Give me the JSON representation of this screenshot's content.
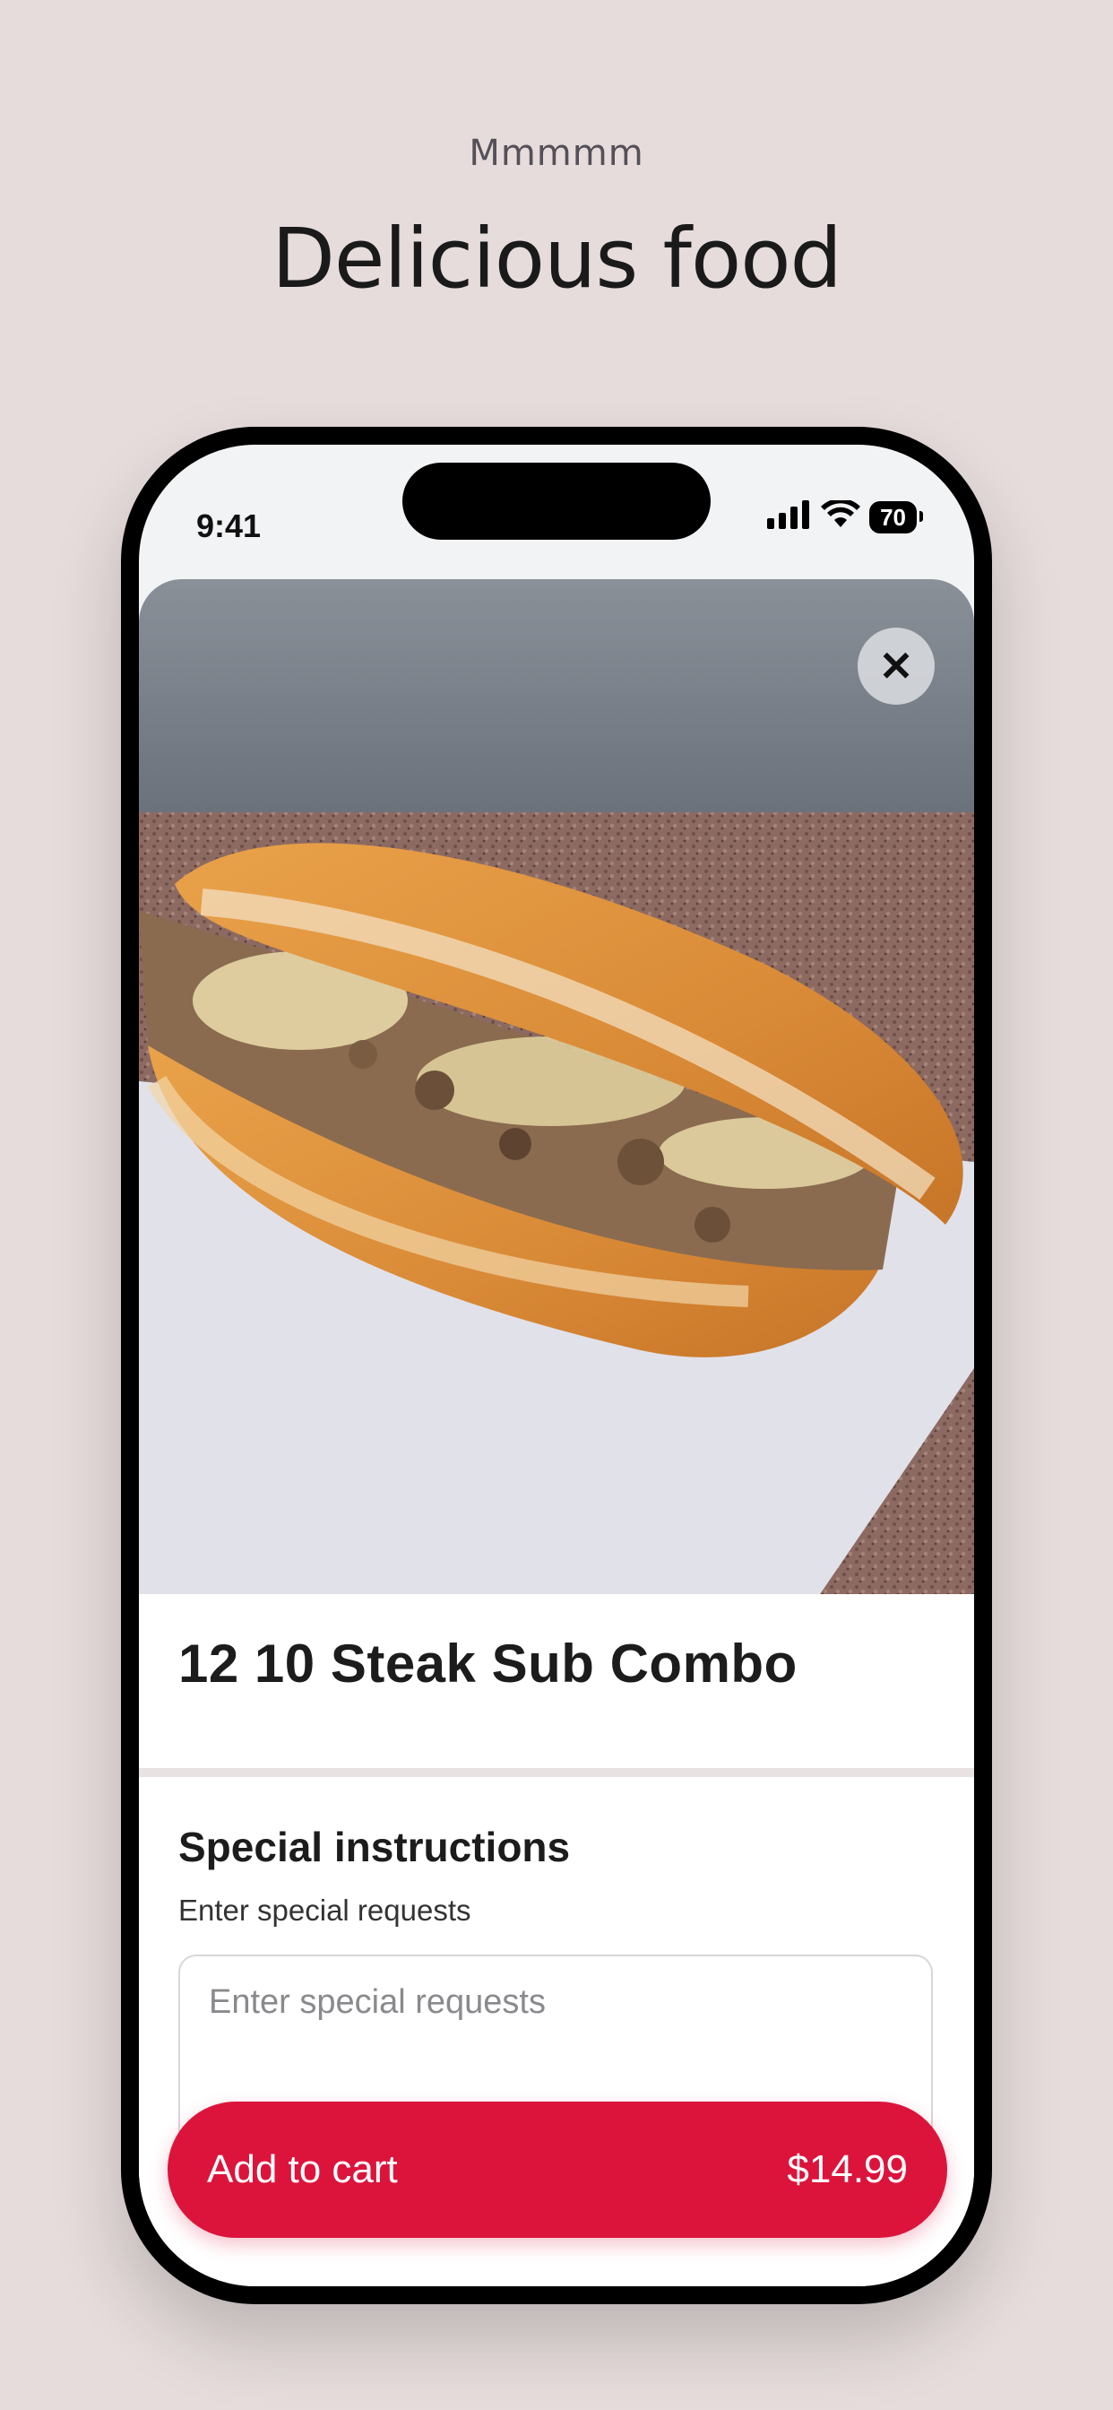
{
  "promo": {
    "subtitle": "Mmmmm",
    "title": "Delicious food"
  },
  "status_bar": {
    "time": "9:41",
    "battery": "70"
  },
  "item": {
    "image_icon": "steak-sub-photo",
    "title": "12 10 Steak Sub Combo"
  },
  "special_instructions": {
    "heading": "Special instructions",
    "subtitle": "Enter special requests",
    "placeholder": "Enter special requests",
    "value": ""
  },
  "cart": {
    "label": "Add to cart",
    "price": "$14.99"
  },
  "colors": {
    "accent": "#dc143c",
    "background": "#e6dcdc"
  }
}
